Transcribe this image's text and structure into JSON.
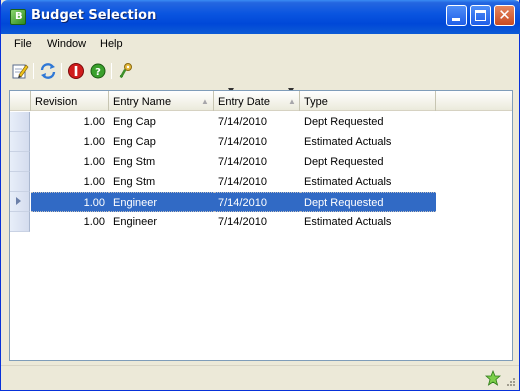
{
  "window": {
    "title": "Budget Selection",
    "icon_letter": "B"
  },
  "menu": {
    "items": [
      "File",
      "Window",
      "Help"
    ]
  },
  "toolbar": {
    "tools": [
      "edit-icon",
      "refresh-icon",
      "stop-icon",
      "help-icon",
      "key-icon"
    ]
  },
  "grid": {
    "columns": [
      {
        "label": "Revision",
        "sort": ""
      },
      {
        "label": "Entry Name",
        "sort": "▲"
      },
      {
        "label": "Entry Date",
        "sort": "▲"
      },
      {
        "label": "Type",
        "sort": ""
      }
    ],
    "rows": [
      {
        "revision": "1.00",
        "entry_name": "Eng Cap",
        "entry_date": "7/14/2010",
        "type": "Dept Requested",
        "selected": false
      },
      {
        "revision": "1.00",
        "entry_name": "Eng Cap",
        "entry_date": "7/14/2010",
        "type": "Estimated Actuals",
        "selected": false
      },
      {
        "revision": "1.00",
        "entry_name": "Eng Stm",
        "entry_date": "7/14/2010",
        "type": "Dept Requested",
        "selected": false
      },
      {
        "revision": "1.00",
        "entry_name": "Eng Stm",
        "entry_date": "7/14/2010",
        "type": "Estimated Actuals",
        "selected": false
      },
      {
        "revision": "1.00",
        "entry_name": "Engineer",
        "entry_date": "7/14/2010",
        "type": "Dept Requested",
        "selected": true
      },
      {
        "revision": "1.00",
        "entry_name": "Engineer",
        "entry_date": "7/14/2010",
        "type": "Estimated Actuals",
        "selected": false
      }
    ]
  },
  "colors": {
    "selection": "#316ac5",
    "titlebar": "#0048d8",
    "accent_green": "#2d8a1f"
  }
}
